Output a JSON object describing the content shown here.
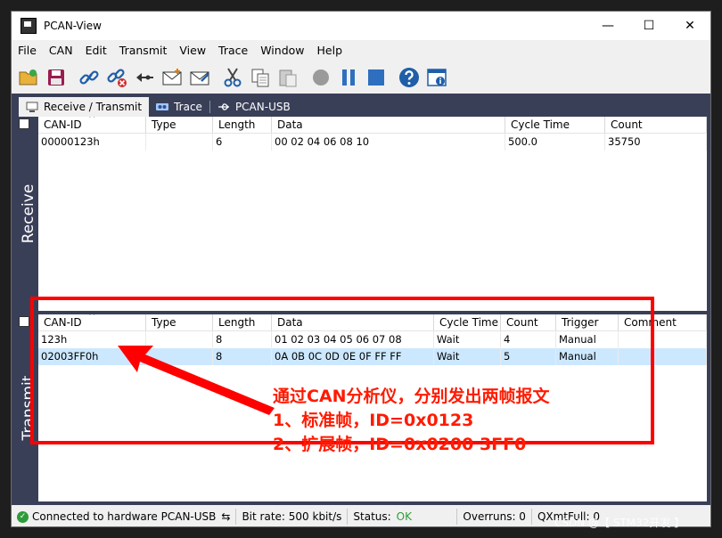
{
  "window": {
    "title": "PCAN-View",
    "minimize": "—",
    "maximize": "☐",
    "close": "✕"
  },
  "menu": [
    "File",
    "CAN",
    "Edit",
    "Transmit",
    "View",
    "Trace",
    "Window",
    "Help"
  ],
  "toolbar_icons": [
    "connect-folder-icon",
    "save-icon",
    "connect-link-icon",
    "disconnect-link-icon",
    "receive-arrow-icon",
    "new-message-icon",
    "edit-message-icon",
    "cut-icon",
    "copy-icon",
    "paste-icon",
    "record-icon",
    "pause-icon",
    "stop-icon",
    "help-icon",
    "about-icon"
  ],
  "tabs": [
    {
      "label": "Receive / Transmit",
      "active": true
    },
    {
      "label": "Trace",
      "active": false
    },
    {
      "label": "PCAN-USB",
      "active": false
    }
  ],
  "receive": {
    "side_label": "Receive",
    "columns": [
      "CAN-ID",
      "Type",
      "Length",
      "Data",
      "Cycle Time",
      "Count"
    ],
    "rows": [
      [
        "00000123h",
        "",
        "6",
        "00 02 04 06 08 10",
        "500.0",
        "35750"
      ]
    ]
  },
  "transmit": {
    "side_label": "Transmit",
    "columns": [
      "CAN-ID",
      "Type",
      "Length",
      "Data",
      "Cycle Time",
      "Count",
      "Trigger",
      "Comment"
    ],
    "rows": [
      [
        "123h",
        "",
        "8",
        "01 02 03 04 05 06 07 08",
        "Wait",
        "4",
        "Manual",
        ""
      ],
      [
        "02003FF0h",
        "",
        "8",
        "0A 0B 0C 0D 0E 0F FF FF",
        "Wait",
        "5",
        "Manual",
        ""
      ]
    ]
  },
  "status": {
    "connection": "Connected to hardware PCAN-USB",
    "bitrate": "Bit rate: 500 kbit/s",
    "status_label": "Status:",
    "status_value": "OK",
    "overruns": "Overruns: 0",
    "qxmtfull": "QXmtFull: 0"
  },
  "annotation": {
    "line1": "通过CAN分析仪，分别发出两帧报文",
    "line2": "1、标准帧，ID=0x0123",
    "line3": "2、扩展帧，ID=0x0200 3FF0"
  },
  "watermark": "CSDN @【 STM32开发 】",
  "colors": {
    "dark_panel": "#3a3f58",
    "selected_row": "#cce8ff",
    "annotation_red": "#ff0000",
    "status_ok": "#2e9b3a"
  }
}
